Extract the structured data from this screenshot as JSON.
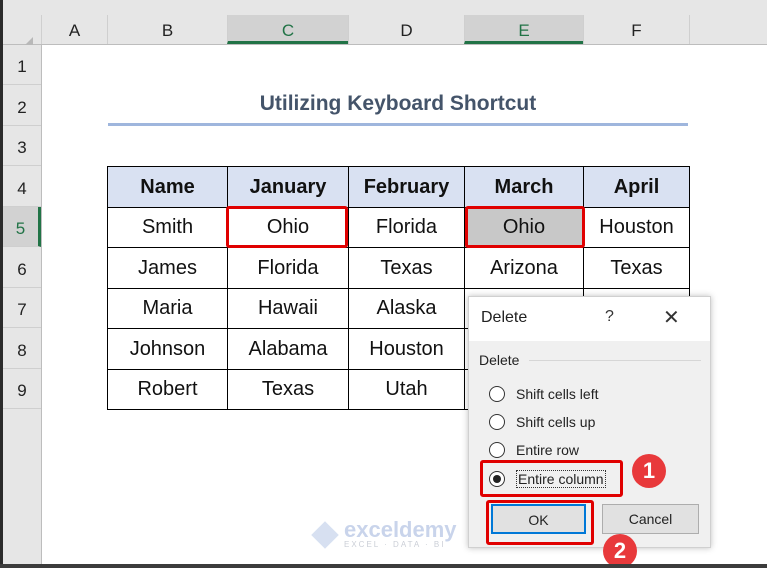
{
  "columns": [
    {
      "label": "A",
      "selected": false
    },
    {
      "label": "B",
      "selected": false
    },
    {
      "label": "C",
      "selected": true
    },
    {
      "label": "D",
      "selected": false
    },
    {
      "label": "E",
      "selected": true
    },
    {
      "label": "F",
      "selected": false
    }
  ],
  "rows": [
    {
      "label": "1",
      "selected": false
    },
    {
      "label": "2",
      "selected": false
    },
    {
      "label": "3",
      "selected": false
    },
    {
      "label": "4",
      "selected": false
    },
    {
      "label": "5",
      "selected": true
    },
    {
      "label": "6",
      "selected": false
    },
    {
      "label": "7",
      "selected": false
    },
    {
      "label": "8",
      "selected": false
    },
    {
      "label": "9",
      "selected": false
    }
  ],
  "sheet_title": "Utilizing Keyboard Shortcut",
  "table": {
    "headers": [
      "Name",
      "January",
      "February",
      "March",
      "April"
    ],
    "rows": [
      [
        "Smith",
        "Ohio",
        "Florida",
        "Ohio",
        "Houston"
      ],
      [
        "James",
        "Florida",
        "Texas",
        "Arizona",
        "Texas"
      ],
      [
        "Maria",
        "Hawaii",
        "Alaska",
        "",
        ""
      ],
      [
        "Johnson",
        "Alabama",
        "Houston",
        "",
        ""
      ],
      [
        "Robert",
        "Texas",
        "Utah",
        "",
        ""
      ]
    ],
    "highlighted_cells": [
      "C5",
      "E5"
    ],
    "selected_cell": "E5"
  },
  "dialog": {
    "title": "Delete",
    "help_label": "?",
    "close_label": "✕",
    "group_label": "Delete",
    "options": [
      {
        "label": "Shift cells left",
        "selected": false
      },
      {
        "label": "Shift cells up",
        "selected": false
      },
      {
        "label": "Entire row",
        "selected": false
      },
      {
        "label": "Entire column",
        "selected": true
      }
    ],
    "ok_label": "OK",
    "cancel_label": "Cancel"
  },
  "badges": [
    "1",
    "2"
  ],
  "accent_color": "#e8393b",
  "watermark": {
    "name": "exceldemy",
    "tagline": "EXCEL · DATA · BI"
  }
}
